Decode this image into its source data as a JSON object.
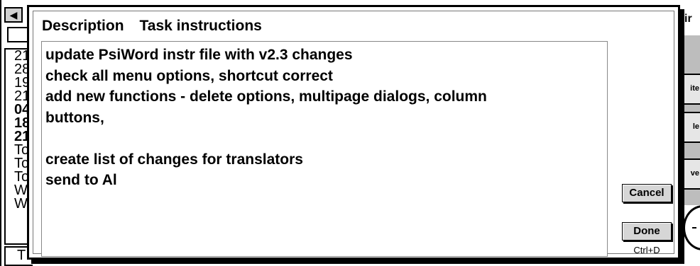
{
  "background_app": {
    "scroll_arrow": "◀",
    "list_items": [
      {
        "text": "21",
        "bold": false
      },
      {
        "text": "28",
        "bold": false
      },
      {
        "text": "19",
        "bold": false
      },
      {
        "text": "21",
        "bold": false
      },
      {
        "text": "04",
        "bold": true
      },
      {
        "text": "18",
        "bold": true
      },
      {
        "text": "21",
        "bold": true
      },
      {
        "text": "To",
        "bold": false
      },
      {
        "text": "To",
        "bold": false
      },
      {
        "text": "To",
        "bold": false
      },
      {
        "text": "W",
        "bold": false
      },
      {
        "text": "W",
        "bold": false
      }
    ],
    "bottom_tab": "T",
    "right_top_label": "ir",
    "right_buttons": [
      "ite",
      "le",
      "ve"
    ]
  },
  "dialog": {
    "tabs": [
      {
        "label": "Description"
      },
      {
        "label": "Task instructions"
      }
    ],
    "text_lines": [
      "update PsiWord instr file with v2.3 changes",
      "check all menu options, shortcut correct",
      "add new functions - delete options, multipage dialogs, column",
      "buttons,",
      "",
      "create list of changes for translators",
      "send to Al"
    ],
    "cancel_label": "Cancel",
    "done_label": "Done",
    "done_shortcut": "Ctrl+D"
  }
}
